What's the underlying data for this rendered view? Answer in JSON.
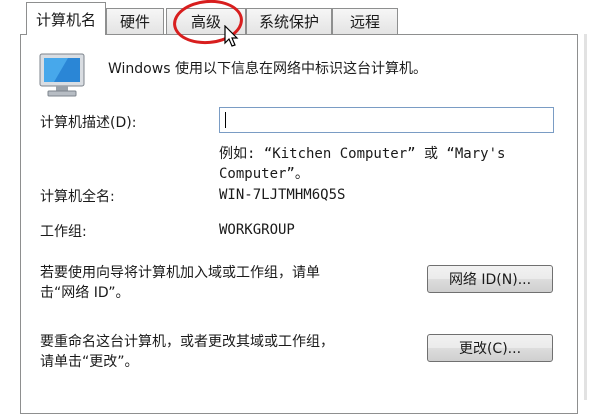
{
  "tabs": [
    {
      "label": "计算机名",
      "active": true
    },
    {
      "label": "硬件",
      "active": false
    },
    {
      "label": "高级",
      "active": false
    },
    {
      "label": "系统保护",
      "active": false
    },
    {
      "label": "远程",
      "active": false
    }
  ],
  "intro_text": "Windows 使用以下信息在网络中标识这台计算机。",
  "description": {
    "label": "计算机描述(D):",
    "value": "",
    "example_line1": "例如: “Kitchen Computer” 或 “Mary's",
    "example_line2": "Computer”。"
  },
  "full_name": {
    "label": "计算机全名:",
    "value": "WIN-7LJTMHM6Q5S"
  },
  "workgroup": {
    "label": "工作组:",
    "value": "WORKGROUP"
  },
  "network_id": {
    "text_line1": "若要使用向导将计算机加入域或工作组，请单",
    "text_line2": "击“网络 ID”。",
    "button_label": "网络 ID(N)..."
  },
  "rename": {
    "text_line1": "要重命名这台计算机，或者更改其域或工作组，",
    "text_line2": "请单击“更改”。",
    "button_label": "更改(C)..."
  },
  "annotation_color": "#d81e1e",
  "icons": {
    "computer": "computer-monitor-icon",
    "cursor": "mouse-pointer-icon"
  }
}
